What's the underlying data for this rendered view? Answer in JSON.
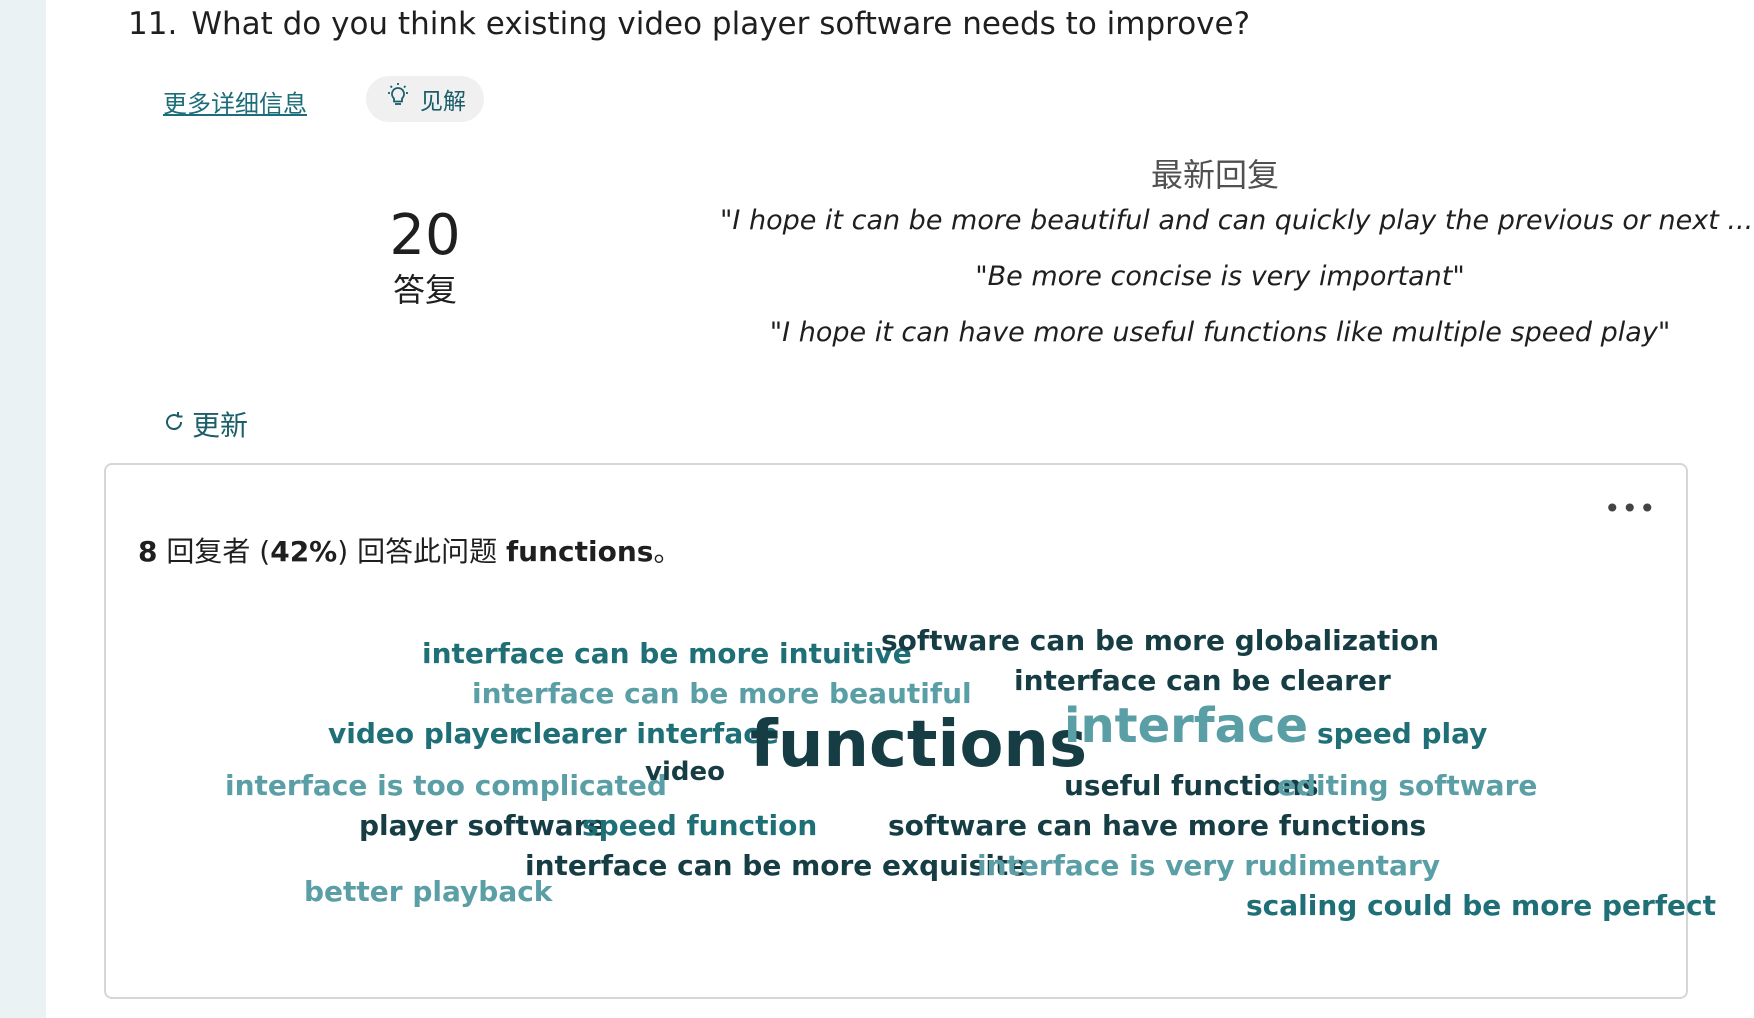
{
  "question": {
    "number": "11.",
    "text": "What do you think existing video player software needs to improve?"
  },
  "links": {
    "more_details": "更多详细信息",
    "insights": "见解"
  },
  "responses": {
    "count": "20",
    "label": "答复"
  },
  "latest": {
    "title": "最新回复",
    "quotes": [
      "\"I hope it can be more beautiful and can quickly play the previous or next ...",
      "\"Be more concise is very important\"",
      "\"I hope it can have more useful functions like multiple speed play\""
    ]
  },
  "refresh_label": "更新",
  "summary": {
    "count": "8",
    "text1": "回复者 (",
    "percent": "42%",
    "text2": ") 回答此问题",
    "keyword": "functions",
    "end": "。"
  },
  "colors": {
    "dark": "#153d43",
    "mid": "#1f6f77",
    "light": "#5a9ea6",
    "accent": "#1b6d7a"
  },
  "word_cloud": [
    {
      "text": "interface can be more intuitive",
      "tone": "mid"
    },
    {
      "text": "software can be more globalization",
      "tone": "dark"
    },
    {
      "text": "interface can be more beautiful",
      "tone": "light"
    },
    {
      "text": "interface can be clearer",
      "tone": "dark"
    },
    {
      "text": "video player",
      "tone": "mid"
    },
    {
      "text": "clearer interface",
      "tone": "mid"
    },
    {
      "text": "functions",
      "tone": "dark"
    },
    {
      "text": "interface",
      "tone": "light"
    },
    {
      "text": "speed play",
      "tone": "mid"
    },
    {
      "text": "interface is too complicated",
      "tone": "light"
    },
    {
      "text": "video",
      "tone": "dark"
    },
    {
      "text": "useful functions",
      "tone": "dark"
    },
    {
      "text": "editing software",
      "tone": "light"
    },
    {
      "text": "player software",
      "tone": "dark"
    },
    {
      "text": "speed function",
      "tone": "mid"
    },
    {
      "text": "software can have more functions",
      "tone": "dark"
    },
    {
      "text": "interface can be more exquisite",
      "tone": "dark"
    },
    {
      "text": "interface is very rudimentary",
      "tone": "light"
    },
    {
      "text": "better playback",
      "tone": "light"
    },
    {
      "text": "scaling could be more perfect",
      "tone": "mid"
    }
  ]
}
